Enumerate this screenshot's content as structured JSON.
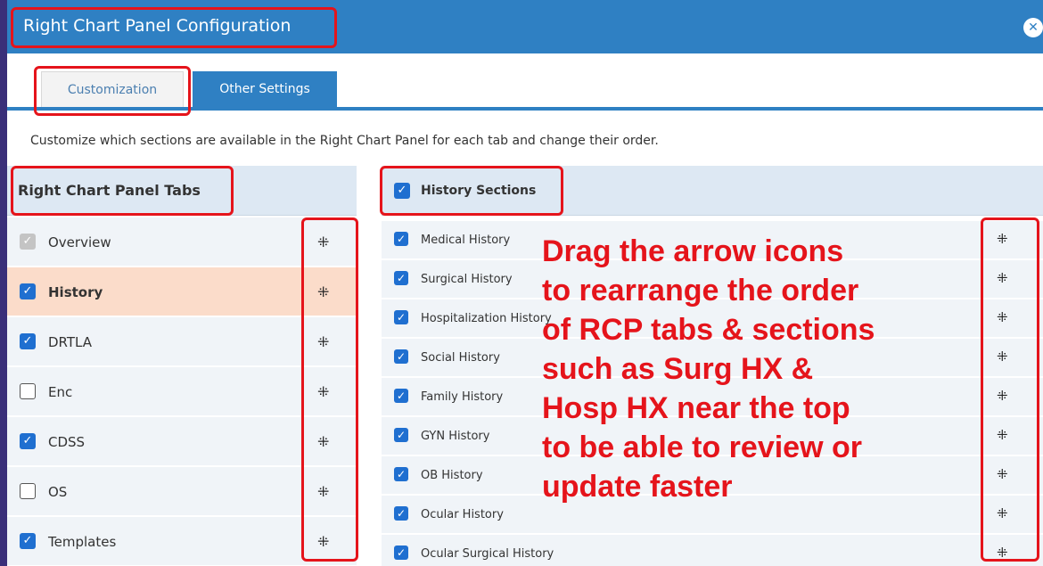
{
  "dialog": {
    "title": "Right Chart Panel Configuration",
    "close_glyph": "✕"
  },
  "tabs": [
    {
      "label": "Customization",
      "active": true
    },
    {
      "label": "Other Settings",
      "active": false
    }
  ],
  "description": "Customize which sections are available in the Right Chart Panel for each tab and change their order.",
  "left_panel": {
    "header": "Right Chart Panel Tabs",
    "drag_icon": "⁜",
    "items": [
      {
        "label": "Overview",
        "state": "disabled"
      },
      {
        "label": "History",
        "state": "checked",
        "active": true
      },
      {
        "label": "DRTLA",
        "state": "checked"
      },
      {
        "label": "Enc",
        "state": "unchecked"
      },
      {
        "label": "CDSS",
        "state": "checked"
      },
      {
        "label": "OS",
        "state": "unchecked"
      },
      {
        "label": "Templates",
        "state": "checked"
      }
    ]
  },
  "right_panel": {
    "header": "History Sections",
    "drag_icon": "⁜",
    "items": [
      {
        "label": "Medical History",
        "state": "checked"
      },
      {
        "label": "Surgical History",
        "state": "checked"
      },
      {
        "label": "Hospitalization History",
        "state": "checked"
      },
      {
        "label": "Social History",
        "state": "checked"
      },
      {
        "label": "Family History",
        "state": "checked"
      },
      {
        "label": "GYN History",
        "state": "checked"
      },
      {
        "label": "OB History",
        "state": "checked"
      },
      {
        "label": "Ocular History",
        "state": "checked"
      },
      {
        "label": "Ocular Surgical History",
        "state": "checked"
      }
    ]
  },
  "annotation": {
    "lines": [
      "Drag the arrow icons",
      "to rearrange the order",
      "of RCP tabs & sections",
      "such as Surg HX &",
      "Hosp HX near the top",
      "to be able to review or",
      "update faster"
    ],
    "color": "#e5141b"
  },
  "colors": {
    "accent": "#2f80c3",
    "checkbox": "#1f6fd0",
    "active_row": "#fbdcca"
  }
}
